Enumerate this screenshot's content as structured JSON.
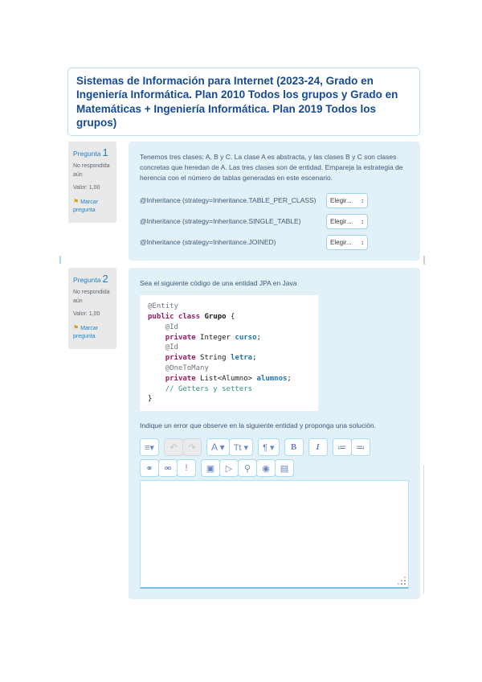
{
  "header": {
    "title": "Sistemas de Información para Internet (2023-24, Grado en Ingeniería Informática. Plan 2010 Todos los grupos y Grado en Matemáticas + Ingeniería Informática. Plan 2019 Todos los grupos)"
  },
  "colors": {
    "accent_blue": "#1f7fc4",
    "header_text": "#164a94",
    "question_panel_bg": "#e2f0f8",
    "info_panel_bg": "#e9e9e9",
    "flag_gold": "#d4a017",
    "toolbar_border": "#a9dbf0",
    "keyword_color": "#a01a63",
    "field_color": "#2176ad",
    "comment_color": "#2f9970"
  },
  "questions": [
    {
      "number_label": "Pregunta",
      "number": "1",
      "status": "No respondida aún",
      "grade": "Valor: 1,00",
      "flag_label": "Marcar pregunta",
      "text": "Tenemos tres clases: A, B y C. La clase A es abstracta, y las clases B y C son clases concretas que heredan de A. Las tres clases son de entidad. Empareja la estrategia de herencia con el número de tablas generadas en este escenario.",
      "match_rows": [
        {
          "label": "@Inheritance (strategy=Inheritance.TABLE_PER_CLASS)",
          "select_value": "Elegir..."
        },
        {
          "label": "@Inheritance (strategy=Inheritance.SINGLE_TABLE)",
          "select_value": "Elegir..."
        },
        {
          "label": "@Inheritance (strategy=Inheritance.JOINED)",
          "select_value": "Elegir..."
        }
      ]
    },
    {
      "number_label": "Pregunta",
      "number": "2",
      "status": "No respondida aún",
      "grade": "Valor: 1,00",
      "flag_label": "Marcar pregunta",
      "intro": "Sea el siguiente código de una entidad JPA en Java",
      "code_lines": [
        [
          [
            "ann",
            "@Entity"
          ]
        ],
        [
          [
            "kw",
            "public class"
          ],
          [
            "pl",
            " "
          ],
          [
            "cls",
            "Grupo"
          ],
          [
            "pl",
            " {"
          ]
        ],
        [
          [
            "ann",
            "    @Id"
          ]
        ],
        [
          [
            "pl",
            "    "
          ],
          [
            "kw",
            "private"
          ],
          [
            "pl",
            " Integer "
          ],
          [
            "fld",
            "curso"
          ],
          [
            "pl",
            ";"
          ]
        ],
        [
          [
            "ann",
            "    @Id"
          ]
        ],
        [
          [
            "pl",
            "    "
          ],
          [
            "kw",
            "private"
          ],
          [
            "pl",
            " String "
          ],
          [
            "fld",
            "letra"
          ],
          [
            "pl",
            ";"
          ]
        ],
        [
          [
            "ann",
            "    @OneToMany"
          ]
        ],
        [
          [
            "pl",
            "    "
          ],
          [
            "kw",
            "private"
          ],
          [
            "pl",
            " List<Alumno> "
          ],
          [
            "fld",
            "alumnos"
          ],
          [
            "pl",
            ";"
          ]
        ],
        [
          [
            "pl",
            "    "
          ],
          [
            "cmt",
            "// Getters y setters"
          ]
        ],
        [
          [
            "pl",
            "}"
          ]
        ]
      ],
      "prompt": "Indique un error que observe en la siguiente entidad y proponga una solución.",
      "editor": {
        "content_value": "",
        "toolbar_rows": [
          {
            "groups": [
              {
                "buttons": [
                  {
                    "name": "toolbar-expand-button",
                    "glyph": "≡▾"
                  }
                ]
              },
              {
                "buttons": [
                  {
                    "name": "undo-icon",
                    "glyph": "↶",
                    "disabled": true
                  },
                  {
                    "name": "redo-icon",
                    "glyph": "↷",
                    "disabled": true
                  }
                ]
              },
              {
                "buttons": [
                  {
                    "name": "font-style-button",
                    "glyph": "A ▾"
                  },
                  {
                    "name": "font-size-button",
                    "glyph": "Tt ▾"
                  }
                ]
              },
              {
                "buttons": [
                  {
                    "name": "paragraph-style-button",
                    "glyph": "¶ ▾"
                  }
                ]
              },
              {
                "buttons": [
                  {
                    "name": "bold-button",
                    "glyph": "B"
                  }
                ]
              },
              {
                "buttons": [
                  {
                    "name": "italic-button",
                    "glyph": "I"
                  }
                ]
              },
              {
                "buttons": [
                  {
                    "name": "unordered-list-button",
                    "glyph": "≔"
                  },
                  {
                    "name": "ordered-list-button",
                    "glyph": "≕"
                  }
                ]
              }
            ]
          },
          {
            "groups": [
              {
                "buttons": [
                  {
                    "name": "link-button",
                    "glyph": "⚭"
                  },
                  {
                    "name": "unlink-button",
                    "glyph": "⚮"
                  },
                  {
                    "name": "prevent-autolink-button",
                    "glyph": "!"
                  }
                ]
              },
              {
                "buttons": [
                  {
                    "name": "insert-image-button",
                    "glyph": "▣"
                  },
                  {
                    "name": "insert-media-button",
                    "glyph": "▷"
                  },
                  {
                    "name": "record-audio-button",
                    "glyph": "⚲"
                  },
                  {
                    "name": "record-video-button",
                    "glyph": "◉"
                  },
                  {
                    "name": "manage-files-button",
                    "glyph": "▤"
                  }
                ]
              }
            ]
          }
        ]
      }
    }
  ]
}
